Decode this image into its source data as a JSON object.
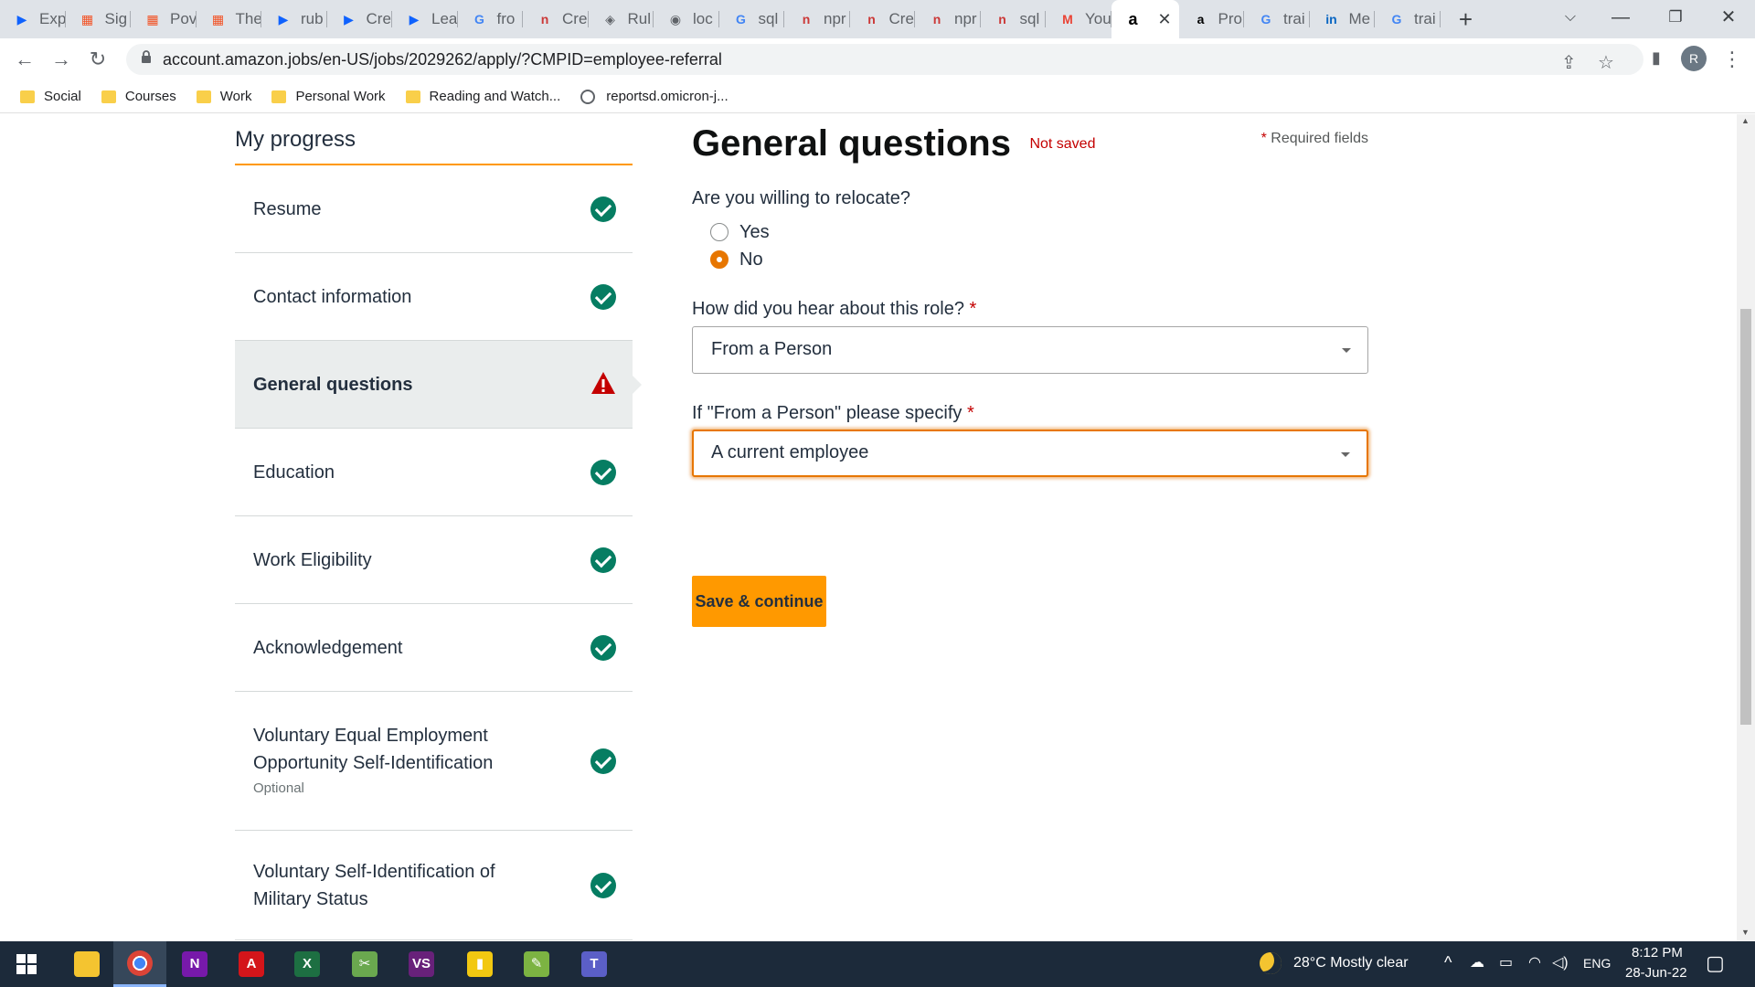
{
  "browser": {
    "tabs": [
      {
        "label": "Exp",
        "icon": "video-icon",
        "color": "#0f62fe"
      },
      {
        "label": "Sig",
        "icon": "microsoft-icon",
        "color": "#f25022"
      },
      {
        "label": "Pov",
        "icon": "microsoft-icon",
        "color": "#f25022"
      },
      {
        "label": "The",
        "icon": "microsoft-icon",
        "color": "#f25022"
      },
      {
        "label": "rub",
        "icon": "video-icon",
        "color": "#0f62fe"
      },
      {
        "label": "Cre",
        "icon": "video-icon",
        "color": "#0f62fe"
      },
      {
        "label": "Lea",
        "icon": "video-icon",
        "color": "#0f62fe"
      },
      {
        "label": "fro",
        "icon": "google-icon",
        "color": "#4285f4"
      },
      {
        "label": "Cre",
        "icon": "npm-icon",
        "color": "#cb3837"
      },
      {
        "label": "Rul",
        "icon": "diamond-icon",
        "color": "#5f6368"
      },
      {
        "label": "loc",
        "icon": "globe-icon",
        "color": "#5f6368"
      },
      {
        "label": "sql",
        "icon": "google-icon",
        "color": "#4285f4"
      },
      {
        "label": "npr",
        "icon": "npm-icon",
        "color": "#cb3837"
      },
      {
        "label": "Cre",
        "icon": "npm-icon",
        "color": "#cb3837"
      },
      {
        "label": "npr",
        "icon": "npm-icon",
        "color": "#cb3837"
      },
      {
        "label": "sql",
        "icon": "npm-icon",
        "color": "#cb3837"
      },
      {
        "label": "You",
        "icon": "gmail-icon",
        "color": "#ea4335"
      }
    ],
    "active_tab": {
      "glyph": "a",
      "close": "✕"
    },
    "tabs_after": [
      {
        "label": "Pro",
        "icon": "amazon-icon",
        "color": "#000000",
        "glyph": "a"
      },
      {
        "label": "trai",
        "icon": "google-icon",
        "color": "#4285f4",
        "glyph": "G"
      },
      {
        "label": "Me",
        "icon": "linkedin-icon",
        "color": "#0a66c2",
        "glyph": "in"
      },
      {
        "label": "trai",
        "icon": "google-icon",
        "color": "#4285f4",
        "glyph": "G"
      }
    ],
    "new_tab": "+",
    "url": "account.amazon.jobs/en-US/jobs/2029262/apply/?CMPID=employee-referral",
    "profile_initial": "R",
    "bookmarks": [
      {
        "label": "Social",
        "type": "folder"
      },
      {
        "label": "Courses",
        "type": "folder"
      },
      {
        "label": "Work",
        "type": "folder"
      },
      {
        "label": "Personal Work",
        "type": "folder"
      },
      {
        "label": "Reading and Watch...",
        "type": "folder"
      },
      {
        "label": "reportsd.omicron-j...",
        "type": "globe"
      }
    ]
  },
  "progress": {
    "title": "My progress",
    "steps": [
      {
        "label": "Resume",
        "status": "complete"
      },
      {
        "label": "Contact information",
        "status": "complete"
      },
      {
        "label": "General questions",
        "status": "warning"
      },
      {
        "label": "Education",
        "status": "complete"
      },
      {
        "label": "Work Eligibility",
        "status": "complete"
      },
      {
        "label": "Acknowledgement",
        "status": "complete"
      },
      {
        "label": "Voluntary Equal Employment Opportunity Self-Identification",
        "sub": "Optional",
        "status": "complete"
      },
      {
        "label": "Voluntary Self-Identification of Military Status",
        "status": "complete"
      }
    ]
  },
  "form": {
    "title": "General questions",
    "save_status": "Not saved",
    "required_note": "Required fields",
    "required_star": "*",
    "q1": {
      "label": "Are you willing to relocate?",
      "options": [
        "Yes",
        "No"
      ],
      "selected": "No"
    },
    "q2": {
      "label": "How did you hear about this role?",
      "value": "From a Person"
    },
    "q3": {
      "label": "If \"From a Person\" please specify",
      "value": "A current employee"
    },
    "save_button": "Save & continue"
  },
  "taskbar": {
    "apps": [
      {
        "name": "file-explorer-icon",
        "glyph": "",
        "color": "#f4c430"
      },
      {
        "name": "chrome-icon",
        "glyph": "",
        "color": "#db4437"
      },
      {
        "name": "onenote-icon",
        "glyph": "N",
        "color": "#7719aa"
      },
      {
        "name": "acrobat-icon",
        "glyph": "A",
        "color": "#d4151a"
      },
      {
        "name": "excel-icon",
        "glyph": "X",
        "color": "#1d6f42"
      },
      {
        "name": "snipping-icon",
        "glyph": "✂",
        "color": "#6aa84f"
      },
      {
        "name": "visual-studio-icon",
        "glyph": "VS",
        "color": "#68217a"
      },
      {
        "name": "power-bi-icon",
        "glyph": "▮",
        "color": "#f2c811"
      },
      {
        "name": "notepad-icon",
        "glyph": "✎",
        "color": "#7cb342"
      },
      {
        "name": "teams-icon",
        "glyph": "T",
        "color": "#5b5fc7"
      }
    ],
    "weather": "28°C  Mostly clear",
    "language": "ENG",
    "time": "8:12 PM",
    "date": "28-Jun-22"
  },
  "colors": {
    "accent": "#ff9900",
    "focus": "#e77600",
    "success": "#067d62",
    "error": "#c40000"
  }
}
